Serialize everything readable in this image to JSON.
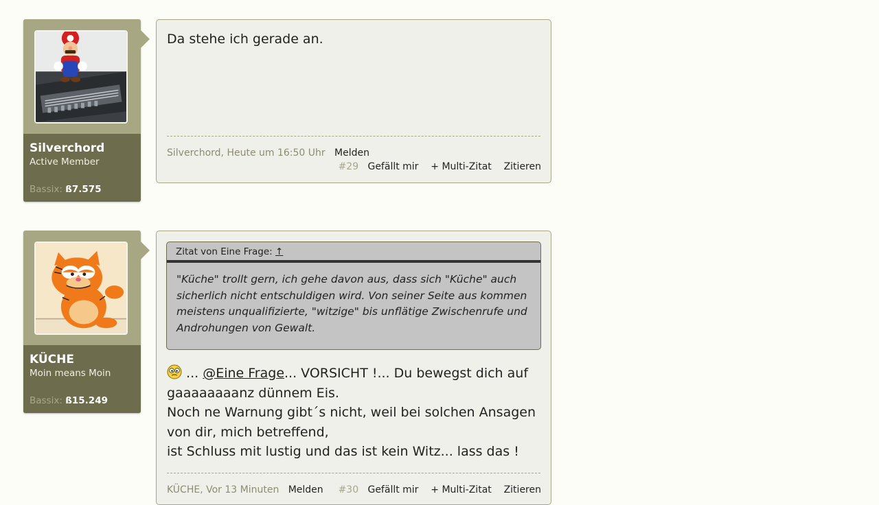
{
  "posts": [
    {
      "user": {
        "name": "Silverchord",
        "title": "Active Member",
        "bassix_label": "Bassix:",
        "bassix_value": "ß7.575",
        "avatar_icon": "mario-avatar"
      },
      "body": "Da stehe ich gerade an.",
      "footer": {
        "author_time": "Silverchord, Heute um 16:50 Uhr",
        "report": "Melden",
        "number": "#29",
        "like": "Gefällt mir",
        "multiquote": "+ Multi-Zitat",
        "quote": "Zitieren"
      }
    },
    {
      "user": {
        "name": "KÜCHE",
        "title": "Moin means Moin",
        "bassix_label": "Bassix:",
        "bassix_value": "ß15.249",
        "avatar_icon": "garfield-avatar"
      },
      "quote": {
        "header": "Zitat von Eine Frage:",
        "arrow": "↑",
        "lines": [
          "\"Küche\" trollt gern, ich gehe davon aus, dass sich \"Küche\" auch",
          "sicherlich nicht entschuldigen wird. Von seiner Seite aus kommen",
          "meistens unqualifizierte, \"witzige\" bis unflätige Zwischenrufe und",
          "Androhungen von Gewalt."
        ]
      },
      "body": {
        "lead": " ... ",
        "mention": "@Eine Frage",
        "rest": "... VORSICHT !... Du bewegst dich auf",
        "lines": [
          "gaaaaaaaanz dünnem Eis.",
          "Noch ne Warnung gibt´s nicht, weil bei solchen Ansagen",
          "von dir, mich betreffend,",
          "ist Schluss mit lustig und das ist kein Witz... lass das !"
        ],
        "smiley_icon": "confused-smiley-icon"
      },
      "footer": {
        "author_time": "KÜCHE, Vor 13 Minuten",
        "report": "Melden",
        "number": "#30",
        "like": "Gefällt mir",
        "multiquote": "+ Multi-Zitat",
        "quote": "Zitieren"
      }
    }
  ],
  "colors": {
    "page_bg": "#fdfdf7",
    "card_light": "#a7a783",
    "card_dark": "#6d6c4c",
    "message_bg": "#f0f0ea",
    "quote_bg": "#c4c4c4"
  }
}
